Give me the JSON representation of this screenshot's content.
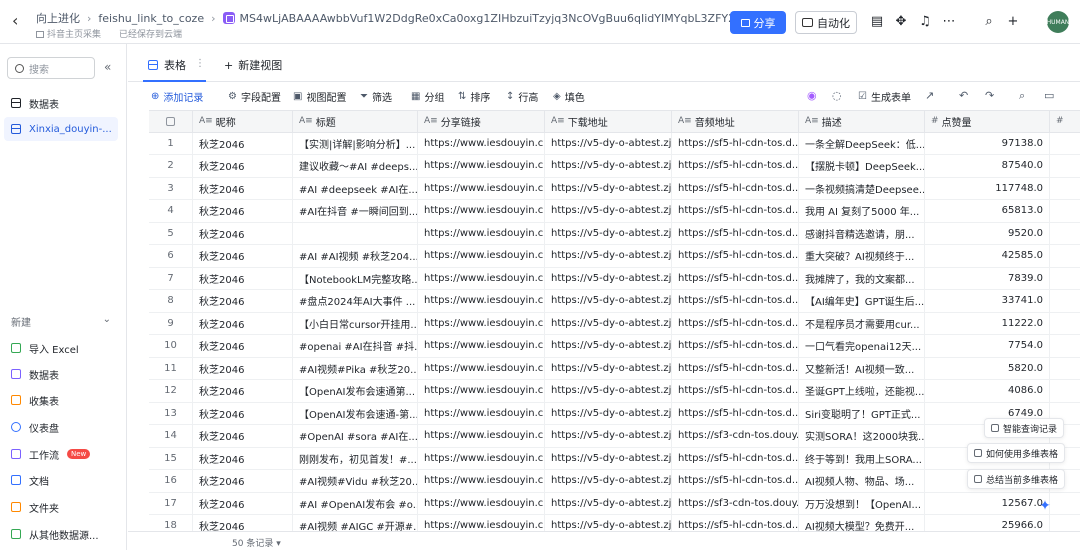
{
  "breadcrumb": {
    "items": [
      "向上进化",
      "feishu_link_to_coze",
      "MS4wLjABAAAAwbbVuf1W2DdgRe0xCa0oxg1ZIHbzuiTzyjq3NcOVgBuu6qIidYIMYqbL3ZFY2swu"
    ],
    "subline_left": "抖音主页采集",
    "subline_right": "已经保存到云端"
  },
  "header": {
    "share_label": "分享",
    "automation_label": "自动化",
    "avatar_text": "HUMAN",
    "accent_color": "#3370ff"
  },
  "sidebar": {
    "search_placeholder": "搜索",
    "items": [
      {
        "label": "数据表"
      },
      {
        "label": "Xinxia_douyin-..."
      }
    ],
    "new_label": "新建",
    "new_items": [
      {
        "label": "导入 Excel",
        "icon": "excel-icon"
      },
      {
        "label": "数据表",
        "icon": "table-icon"
      },
      {
        "label": "收集表",
        "icon": "form-icon"
      },
      {
        "label": "仪表盘",
        "icon": "dashboard-icon"
      },
      {
        "label": "工作流",
        "icon": "workflow-icon",
        "badge": "New"
      },
      {
        "label": "文档",
        "icon": "doc-icon"
      },
      {
        "label": "文件夹",
        "icon": "folder-icon"
      },
      {
        "label": "从其他数据源...",
        "icon": "datasource-icon"
      }
    ]
  },
  "views": {
    "active_tab": "表格",
    "new_view_label": "新建视图"
  },
  "toolbar": {
    "add_record": "添加记录",
    "field_config": "字段配置",
    "view_config": "视图配置",
    "filter": "筛选",
    "group": "分组",
    "sort": "排序",
    "row_height": "行高",
    "fill": "填色",
    "generate_form": "生成表单"
  },
  "table": {
    "columns": [
      "昵称",
      "标题",
      "分享链接",
      "下载地址",
      "音频地址",
      "描述",
      "点赞量"
    ],
    "rows": [
      [
        "1",
        "秋芝2046",
        "【实测|详解|影响分析】...",
        "https://www.iesdouyin.c...",
        "https://v5-dy-o-abtest.zj...",
        "https://sf5-hl-cdn-tos.d...",
        "一条全解DeepSeek：低...",
        "97138.0"
      ],
      [
        "2",
        "秋芝2046",
        "建议收藏～#AI #deeps...",
        "https://www.iesdouyin.c...",
        "https://v5-dy-o-abtest.zj...",
        "https://sf5-hl-cdn-tos.d...",
        "【摆脱卡顿】DeepSeek...",
        "87540.0"
      ],
      [
        "3",
        "秋芝2046",
        "#AI #deepseek #AI在...",
        "https://www.iesdouyin.c...",
        "https://v5-dy-o-abtest.zj...",
        "https://sf5-hl-cdn-tos.d...",
        "一条视频搞清楚Deepsee...",
        "117748.0"
      ],
      [
        "4",
        "秋芝2046",
        "#AI在抖音 #一瞬间回到...",
        "https://www.iesdouyin.c...",
        "https://v5-dy-o-abtest.zj...",
        "https://sf5-hl-cdn-tos.d...",
        "我用 AI 复刻了5000 年...",
        "65813.0"
      ],
      [
        "5",
        "秋芝2046",
        "",
        "https://www.iesdouyin.c...",
        "https://v5-dy-o-abtest.zj...",
        "https://sf5-hl-cdn-tos.d...",
        "感谢抖音精选邀请，朋...",
        "9520.0"
      ],
      [
        "6",
        "秋芝2046",
        "#AI #AI视频 #秋芝204...",
        "https://www.iesdouyin.c...",
        "https://v5-dy-o-abtest.zj...",
        "https://sf5-hl-cdn-tos.d...",
        "重大突破？AI视频终于...",
        "42585.0"
      ],
      [
        "7",
        "秋芝2046",
        "【NotebookLM完整攻略...",
        "https://www.iesdouyin.c...",
        "https://v5-dy-o-abtest.zj...",
        "https://sf5-hl-cdn-tos.d...",
        "我摊牌了，我的文案都...",
        "7839.0"
      ],
      [
        "8",
        "秋芝2046",
        "#盘点2024年AI大事件 ...",
        "https://www.iesdouyin.c...",
        "https://v5-dy-o-abtest.zj...",
        "https://sf5-hl-cdn-tos.d...",
        "【AI编年史】GPT诞生后...",
        "33741.0"
      ],
      [
        "9",
        "秋芝2046",
        "【小白日常cursor开挂用...",
        "https://www.iesdouyin.c...",
        "https://v5-dy-o-abtest.zj...",
        "https://sf5-hl-cdn-tos.d...",
        "不是程序员才需要用cur...",
        "11222.0"
      ],
      [
        "10",
        "秋芝2046",
        "#openai #AI在抖音 #抖...",
        "https://www.iesdouyin.c...",
        "https://v5-dy-o-abtest.zj...",
        "https://sf5-hl-cdn-tos.d...",
        "一口气看完openai12天...",
        "7754.0"
      ],
      [
        "11",
        "秋芝2046",
        "#AI视频#Pika #秋芝20...",
        "https://www.iesdouyin.c...",
        "https://v5-dy-o-abtest.zj...",
        "https://sf5-hl-cdn-tos.d...",
        "又整新活！AI视频一致...",
        "5820.0"
      ],
      [
        "12",
        "秋芝2046",
        "【OpenAI发布会速通第...",
        "https://www.iesdouyin.c...",
        "https://v5-dy-o-abtest.zj...",
        "https://sf5-hl-cdn-tos.d...",
        "圣诞GPT上线啦，还能视...",
        "4086.0"
      ],
      [
        "13",
        "秋芝2046",
        "【OpenAI发布会速通-第...",
        "https://www.iesdouyin.c...",
        "https://v5-dy-o-abtest.zj...",
        "https://sf5-hl-cdn-tos.d...",
        "Siri变聪明了！GPT正式...",
        "6749.0"
      ],
      [
        "14",
        "秋芝2046",
        "#OpenAI #sora #AI在...",
        "https://www.iesdouyin.c...",
        "https://v5-dy-o-abtest.zj...",
        "https://sf3-cdn-tos.douy...",
        "实测SORA！这2000块我...",
        "12335.0"
      ],
      [
        "15",
        "秋芝2046",
        "刚刚发布，初见首发！#...",
        "https://www.iesdouyin.c...",
        "https://v5-dy-o-abtest.zj...",
        "https://sf5-hl-cdn-tos.d...",
        "终于等到！我用上SORA...",
        "15661.0"
      ],
      [
        "16",
        "秋芝2046",
        "#AI视频#Vidu #秋芝20...",
        "https://www.iesdouyin.c...",
        "https://v5-dy-o-abtest.zj...",
        "https://sf5-hl-cdn-tos.d...",
        "AI视频人物、物品、场...",
        "17026.0"
      ],
      [
        "17",
        "秋芝2046",
        "#AI #OpenAI发布会 #o...",
        "https://www.iesdouyin.c...",
        "https://v5-dy-o-abtest.zj...",
        "https://sf3-cdn-tos.douy...",
        "万万没想到！【OpenAI...",
        "12567.0"
      ],
      [
        "18",
        "秋芝2046",
        "#AI视频 #AIGC #开源#...",
        "https://www.iesdouyin.c...",
        "https://v5-dy-o-abtest.zj...",
        "https://sf5-hl-cdn-tos.d...",
        "AI视频大模型？免费开...",
        "25966.0"
      ]
    ]
  },
  "footer": {
    "record_count": "50 条记录"
  },
  "helpers": {
    "smart_query": "智能查询记录",
    "how_to_use": "如何使用多维表格",
    "summarize": "总结当前多维表格"
  }
}
